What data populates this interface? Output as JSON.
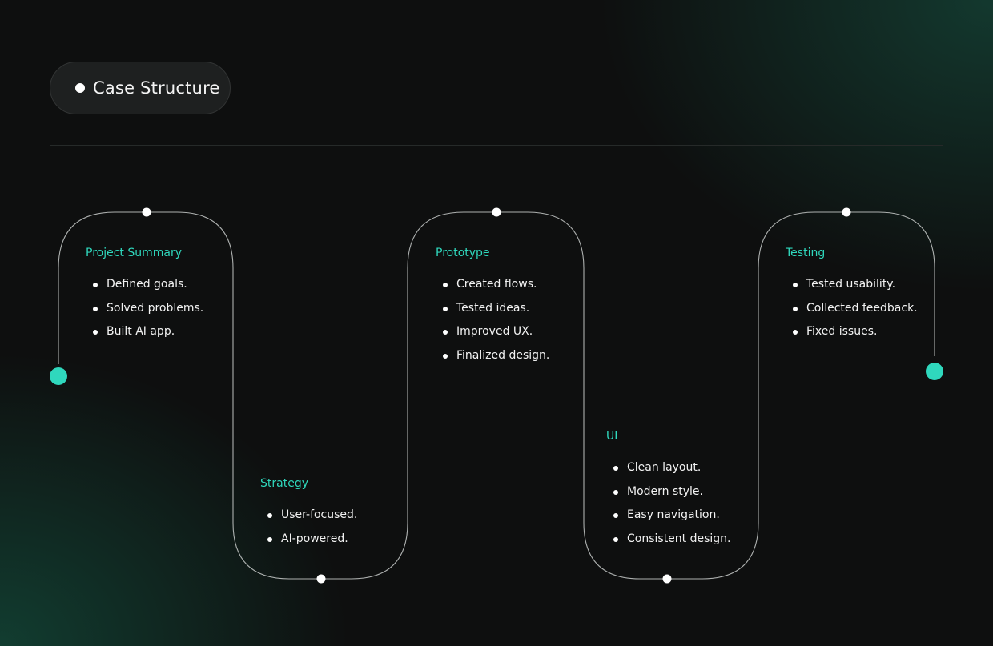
{
  "header": {
    "badge_label": "Case Structure"
  },
  "colors": {
    "accent": "#2fd8bd",
    "background": "#0e0f0f",
    "line": "#c9cccb",
    "text": "#f2f2f2"
  },
  "steps": [
    {
      "title": "Project Summary",
      "items": [
        "Defined goals.",
        "Solved problems.",
        "Built AI app."
      ]
    },
    {
      "title": "Strategy",
      "items": [
        "User-focused.",
        "AI-powered."
      ]
    },
    {
      "title": "Prototype",
      "items": [
        "Created flows.",
        "Tested ideas.",
        "Improved UX.",
        "Finalized design."
      ]
    },
    {
      "title": "UI",
      "items": [
        "Clean layout.",
        "Modern style.",
        "Easy navigation.",
        "Consistent design."
      ]
    },
    {
      "title": "Testing",
      "items": [
        "Tested usability.",
        "Collected feedback.",
        "Fixed issues."
      ]
    }
  ]
}
